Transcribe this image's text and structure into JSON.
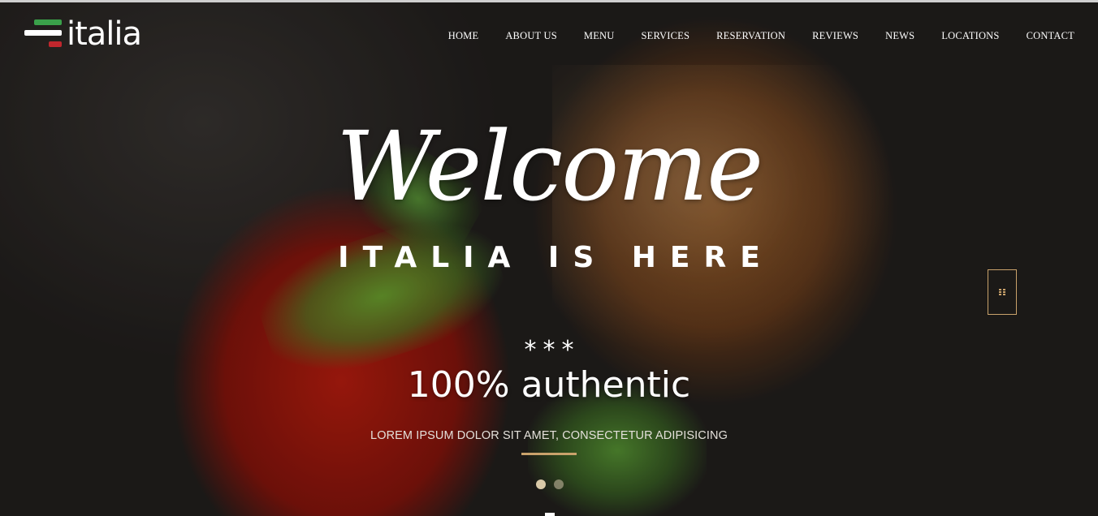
{
  "brand": {
    "name": "italia"
  },
  "nav": {
    "items": [
      "HOME",
      "ABOUT US",
      "MENU",
      "SERVICES",
      "RESERVATION",
      "REVIEWS",
      "NEWS",
      "LOCATIONS",
      "CONTACT"
    ]
  },
  "hero": {
    "welcome": "Welcome",
    "subtitle": "ITALIA IS HERE",
    "stars": "***",
    "headline": "100% authentic",
    "tagline": "LOREM IPSUM DOLOR SIT AMET, CONSECTETUR ADIPISICING",
    "slides": {
      "count": 2,
      "active": 1
    }
  },
  "colors": {
    "accent": "#c9a26b",
    "flag_green": "#3aa14a",
    "flag_white": "#ffffff",
    "flag_red": "#c0272d"
  },
  "icons": {
    "side_toggle": "grip-icon"
  }
}
